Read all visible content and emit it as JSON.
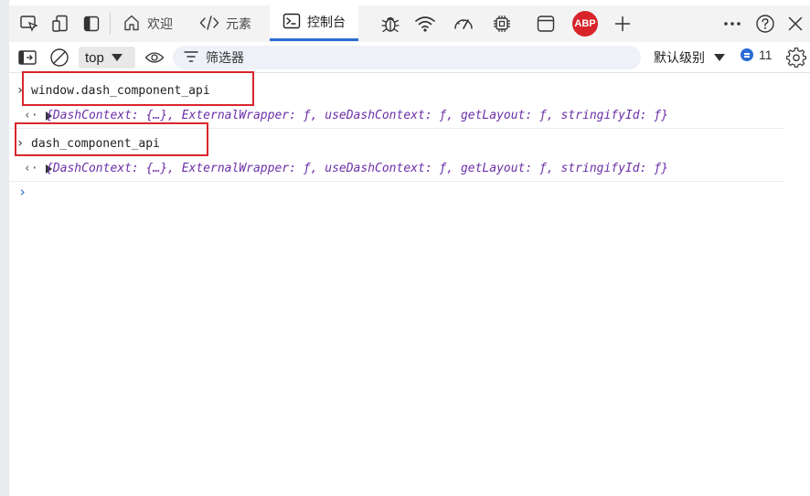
{
  "tabs": [
    {
      "label": "欢迎",
      "icon": "home-icon"
    },
    {
      "label": "元素",
      "icon": "code-icon"
    },
    {
      "label": "控制台",
      "icon": "console-icon"
    }
  ],
  "tool_icons": [
    "inspect-icon",
    "device-emulation-icon",
    "dock-icon",
    "bug-icon",
    "network-wifi-icon",
    "performance-gauge-icon",
    "memory-chip-icon",
    "application-panel-icon",
    "abp-adblock-icon",
    "add-tab-icon",
    "more-icon",
    "help-icon",
    "close-icon"
  ],
  "abp_label": "ABP",
  "toolbar": {
    "context": "top",
    "filter_placeholder": "筛选器",
    "log_level": "默认级别",
    "message_count": "11"
  },
  "console": {
    "entries": [
      {
        "input": "window.dash_component_api",
        "output": "{DashContext: {…}, ExternalWrapper: ƒ, useDashContext: ƒ, getLayout: ƒ, stringifyId: ƒ}"
      },
      {
        "input": "dash_component_api",
        "output": "{DashContext: {…}, ExternalWrapper: ƒ, useDashContext: ƒ, getLayout: ƒ, stringifyId: ƒ}"
      }
    ],
    "prompt_symbol": "›",
    "result_symbol": "‹·"
  },
  "colors": {
    "accent": "#2b6cd4",
    "highlight": "#d9262c",
    "object_text": "#6b2fa8"
  }
}
